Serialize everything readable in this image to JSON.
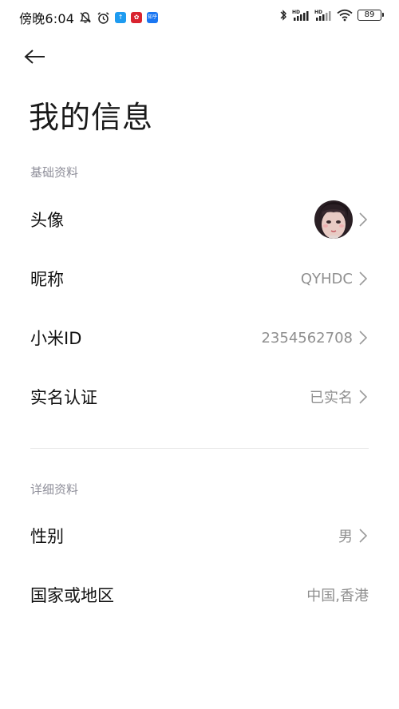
{
  "status_bar": {
    "time": "傍晚6:04",
    "apps": [
      {
        "icon": "arrow-up-app-icon",
        "color": "#1e9bf0",
        "glyph": "↑"
      },
      {
        "icon": "red-app-icon",
        "color": "#d9232f",
        "glyph": "✿"
      },
      {
        "icon": "zhihu-app-icon",
        "color": "#1a76f2",
        "glyph": "知乎"
      }
    ],
    "battery": "89"
  },
  "page": {
    "title": "我的信息"
  },
  "sections": {
    "basic": {
      "header": "基础资料",
      "rows": {
        "avatar": {
          "label": "头像"
        },
        "nickname": {
          "label": "昵称",
          "value": "QYHDC"
        },
        "mi_id": {
          "label": "小米ID",
          "value": "2354562708"
        },
        "verification": {
          "label": "实名认证",
          "value": "已实名"
        }
      }
    },
    "detail": {
      "header": "详细资料",
      "rows": {
        "gender": {
          "label": "性别",
          "value": "男"
        },
        "region": {
          "label": "国家或地区",
          "value": "中国,香港"
        }
      }
    }
  },
  "colors": {
    "text_primary": "#111111",
    "text_secondary": "#8f8f8f",
    "section_header": "#8f8f9a",
    "divider": "#e6e6e6",
    "background": "#ffffff"
  }
}
